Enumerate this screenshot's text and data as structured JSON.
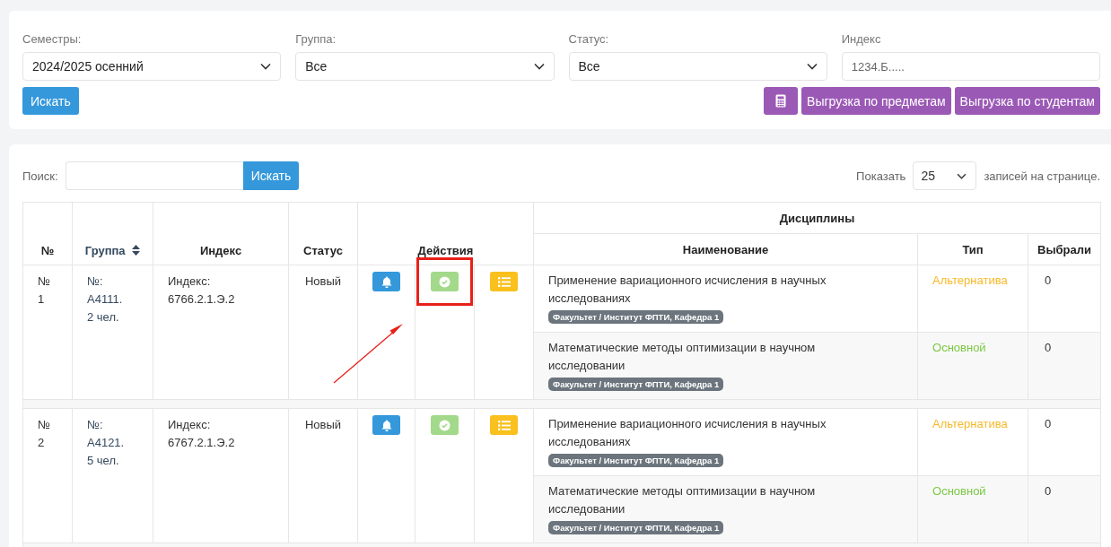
{
  "filters": [
    {
      "kind": "select",
      "label": "Семестры:",
      "value": "2024/2025 осенний"
    },
    {
      "kind": "select",
      "label": "Группа:",
      "value": "Все"
    },
    {
      "kind": "select",
      "label": "Статус:",
      "value": "Все"
    },
    {
      "kind": "input",
      "label": "Индекс",
      "placeholder": "1234.Б....."
    }
  ],
  "filter_button": "Искать",
  "export_buttons": [
    "Выгрузка по предметам",
    "Выгрузка по студентам"
  ],
  "table_search": {
    "label": "Поиск:",
    "button": "Искать"
  },
  "page_size": {
    "before": "Показать",
    "value": "25",
    "after": "записей на странице."
  },
  "columns": {
    "number": "№",
    "group": "Группа",
    "index": "Индекс",
    "status": "Статус",
    "actions": "Действия",
    "disciplines": "Дисциплины",
    "name": "Наименование",
    "type": "Тип",
    "chosen": "Выбрали"
  },
  "rows": [
    {
      "number": [
        "№",
        "1"
      ],
      "group": [
        "№:",
        "A4111.",
        "2 чел."
      ],
      "index": [
        "Индекс:",
        "6766.2.1.Э.2"
      ],
      "status": "Новый",
      "actions": [
        {
          "kind": "notify",
          "highlighted": false
        },
        {
          "kind": "approve",
          "highlighted": true
        },
        {
          "kind": "list",
          "highlighted": false
        }
      ],
      "disciplines": [
        {
          "name": "Применение вариационного исчисления в научных исследованиях",
          "department": "Факультет / Институт ФПТИ, Кафедра 1",
          "type": "Альтернатива",
          "color": "#f6b928",
          "chosen": "0"
        },
        {
          "name": "Математические методы оптимизации в научном исследовании",
          "department": "Факультет / Институт ФПТИ, Кафедра 1",
          "type": "Основной",
          "color": "#7ac943",
          "chosen": "0"
        }
      ]
    },
    {
      "number": [
        "№",
        "2"
      ],
      "group": [
        "№:",
        "A4121.",
        "5 чел."
      ],
      "index": [
        "Индекс:",
        "6767.2.1.Э.2"
      ],
      "status": "Новый",
      "actions": [
        {
          "kind": "notify",
          "highlighted": false
        },
        {
          "kind": "approve",
          "highlighted": false
        },
        {
          "kind": "list",
          "highlighted": false
        }
      ],
      "disciplines": [
        {
          "name": "Применение вариационного исчисления в научных исследованиях",
          "department": "Факультет / Институт ФПТИ, Кафедра 1",
          "type": "Альтернатива",
          "color": "#f6b928",
          "chosen": "0"
        },
        {
          "name": "Математические методы оптимизации в научном исследовании",
          "department": "Факультет / Институт ФПТИ, Кафедра 1",
          "type": "Основной",
          "color": "#7ac943",
          "chosen": "0"
        }
      ]
    }
  ]
}
